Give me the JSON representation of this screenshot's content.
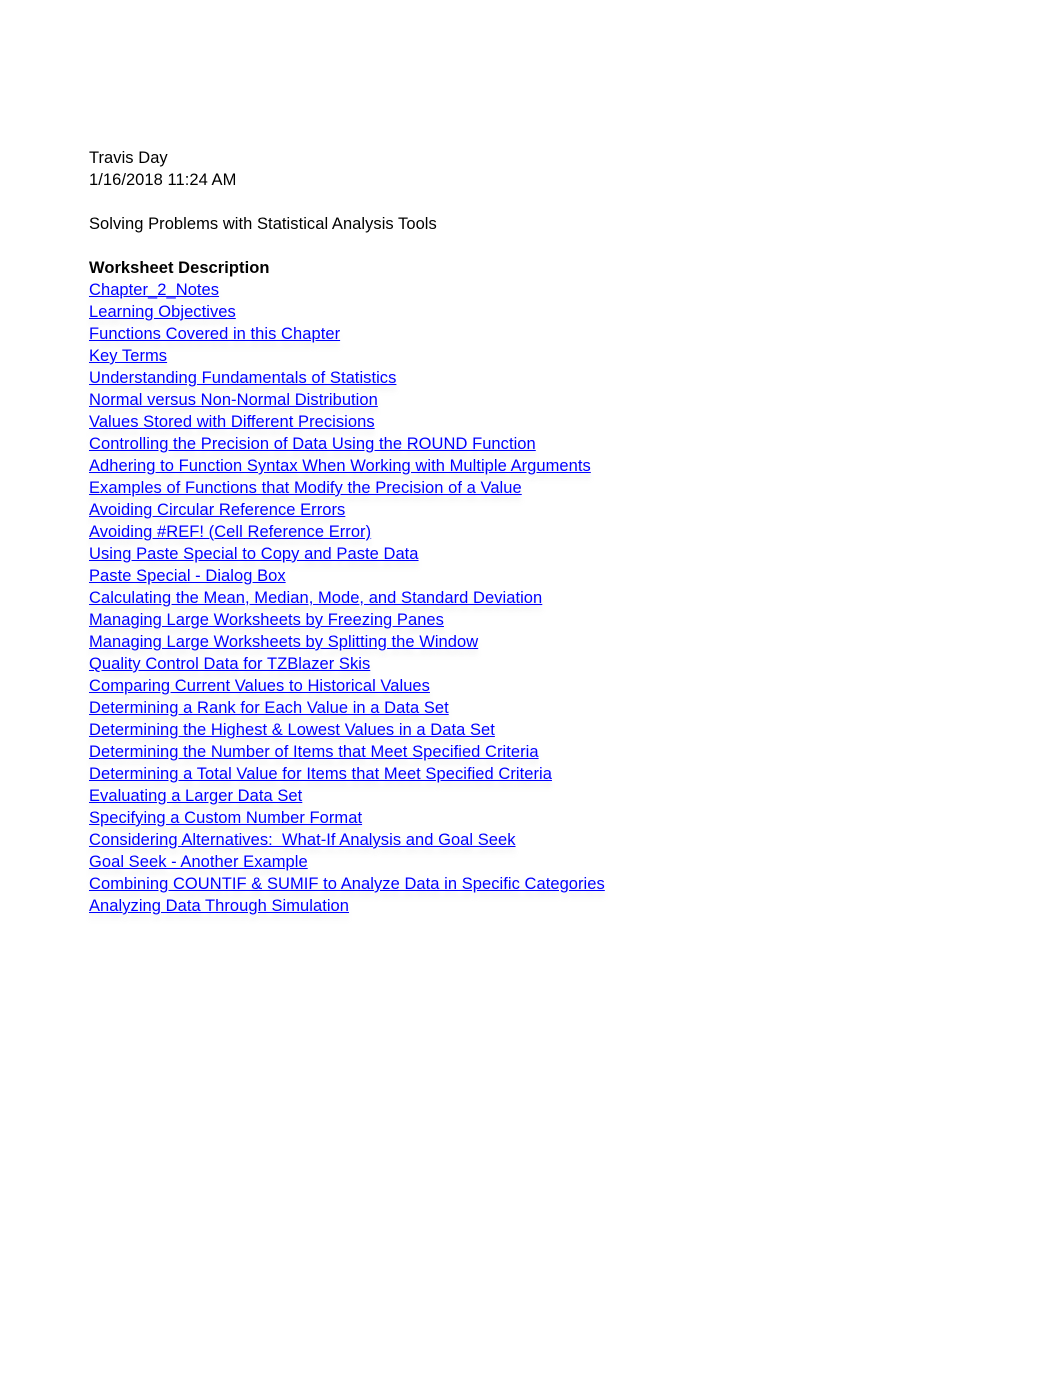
{
  "document": {
    "author": "Travis Day",
    "timestamp": "1/16/2018 11:24 AM",
    "subject": "Solving Problems with Statistical Analysis Tools",
    "section_heading": "Worksheet Description",
    "link_color": "#0000FF",
    "text_color": "#000000",
    "background_color": "#FFFFFF"
  },
  "links": [
    {
      "label": "Chapter_2_Notes"
    },
    {
      "label": "Learning Objectives"
    },
    {
      "label": "Functions Covered in this Chapter"
    },
    {
      "label": "Key Terms"
    },
    {
      "label": "Understanding Fundamentals of Statistics"
    },
    {
      "label": "Normal versus Non-Normal Distribution"
    },
    {
      "label": "Values Stored with Different Precisions"
    },
    {
      "label": "Controlling the Precision of Data Using the ROUND Function"
    },
    {
      "label": "Adhering to Function Syntax When Working with Multiple Arguments"
    },
    {
      "label": "Examples of Functions that Modify the Precision of a Value"
    },
    {
      "label": "Avoiding Circular Reference Errors"
    },
    {
      "label": "Avoiding #REF! (Cell Reference Error)"
    },
    {
      "label": "Using Paste Special to Copy and Paste Data"
    },
    {
      "label": "Paste Special - Dialog Box"
    },
    {
      "label": "Calculating the Mean, Median, Mode, and Standard Deviation"
    },
    {
      "label": "Managing Large Worksheets by Freezing Panes"
    },
    {
      "label": "Managing Large Worksheets by Splitting the Window"
    },
    {
      "label": "Quality Control Data for TZBlazer Skis"
    },
    {
      "label": "Comparing Current Values to Historical Values"
    },
    {
      "label": "Determining a Rank for Each Value in a Data Set"
    },
    {
      "label": "Determining the Highest & Lowest Values in a Data Set"
    },
    {
      "label": "Determining the Number of Items that Meet Specified Criteria"
    },
    {
      "label": "Determining a Total Value for Items that Meet Specified Criteria"
    },
    {
      "label": "Evaluating a Larger Data Set"
    },
    {
      "label": "Specifying a Custom Number Format"
    },
    {
      "label": "Considering Alternatives:  What-If Analysis and Goal Seek"
    },
    {
      "label": "Goal Seek - Another Example"
    },
    {
      "label": "Combining COUNTIF & SUMIF to Analyze Data in Specific Categories"
    },
    {
      "label": "Analyzing Data Through Simulation"
    }
  ]
}
